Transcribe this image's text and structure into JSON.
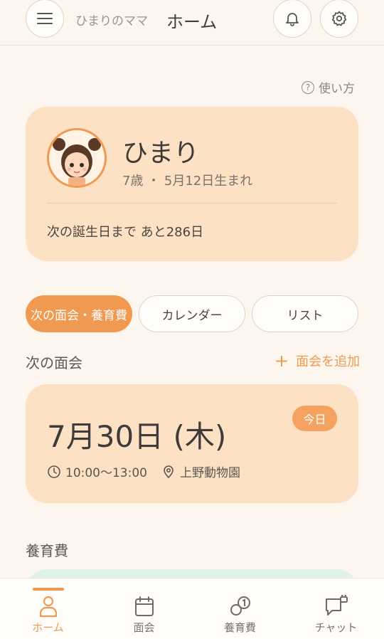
{
  "header": {
    "user_name": "ひまりのママ",
    "title": "ホーム"
  },
  "help_label": "使い方",
  "profile": {
    "name": "ひまり",
    "meta": "7歳 ・ 5月12日生まれ",
    "birthday_countdown": "次の誕生日まで あと286日"
  },
  "tabs": [
    {
      "label": "次の面会・養育費"
    },
    {
      "label": "カレンダー"
    },
    {
      "label": "リスト"
    }
  ],
  "next_visit": {
    "section_title": "次の面会",
    "add_label": "面会を追加",
    "date": "7月30日 (木)",
    "badge": "今日",
    "time": "10:00〜13:00",
    "location": "上野動物園"
  },
  "support": {
    "section_title": "養育費"
  },
  "bottom_nav": [
    {
      "label": "ホーム",
      "icon": "person-icon"
    },
    {
      "label": "面会",
      "icon": "calendar-icon"
    },
    {
      "label": "養育費",
      "icon": "coins-icon"
    },
    {
      "label": "チャット",
      "icon": "chat-lock-icon"
    }
  ],
  "colors": {
    "accent": "#f09a51",
    "card": "#fde1c5",
    "background": "#fdf6ee",
    "support_card": "#dff3e8"
  }
}
